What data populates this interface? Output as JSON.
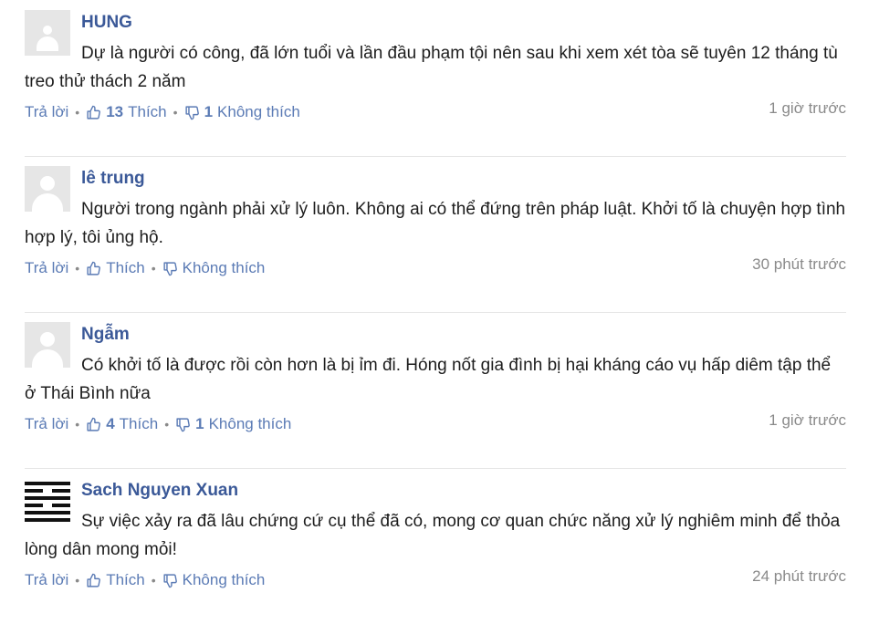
{
  "comments": [
    {
      "author": "HUNG",
      "text": "Dự là người có công, đã lớn tuổi và lần đầu phạm tội nên sau khi xem xét tòa sẽ tuyên 12 tháng tù treo thử thách 2 năm",
      "reply_label": "Trả lời",
      "like_count": "13",
      "like_label": "Thích",
      "dislike_count": "1",
      "dislike_label": "Không thích",
      "time": "1 giờ trước"
    },
    {
      "author": "lê trung",
      "text": "Người trong ngành phải xử lý luôn. Không ai có thể đứng trên pháp luật. Khởi tố là chuyện hợp tình hợp lý, tôi ủng hộ.",
      "reply_label": "Trả lời",
      "like_count": "",
      "like_label": "Thích",
      "dislike_count": "",
      "dislike_label": "Không thích",
      "time": "30 phút trước"
    },
    {
      "author": "Ngẫm",
      "text": "Có khởi tố là được rồi còn hơn là bị ỉm đi. Hóng nốt gia đình bị hại kháng cáo vụ hấp diêm tập thể ở Thái Bình nữa",
      "reply_label": "Trả lời",
      "like_count": "4",
      "like_label": "Thích",
      "dislike_count": "1",
      "dislike_label": "Không thích",
      "time": "1 giờ trước"
    },
    {
      "author": "Sach Nguyen Xuan",
      "text": "Sự việc xảy ra đã lâu chứng cứ cụ thể đã có, mong cơ quan chức năng xử lý nghiêm minh để thỏa lòng dân mong mỏi!",
      "reply_label": "Trả lời",
      "like_count": "",
      "like_label": "Thích",
      "dislike_count": "",
      "dislike_label": "Không thích",
      "time": "24 phút trước"
    }
  ],
  "icons": {
    "like": "thumbs-up-icon",
    "dislike": "thumbs-down-icon",
    "separator": "•"
  },
  "colors": {
    "author": "#3b5998",
    "action": "#5b7bb5",
    "muted": "#8a8a8a",
    "divider": "#e5e5e5"
  }
}
